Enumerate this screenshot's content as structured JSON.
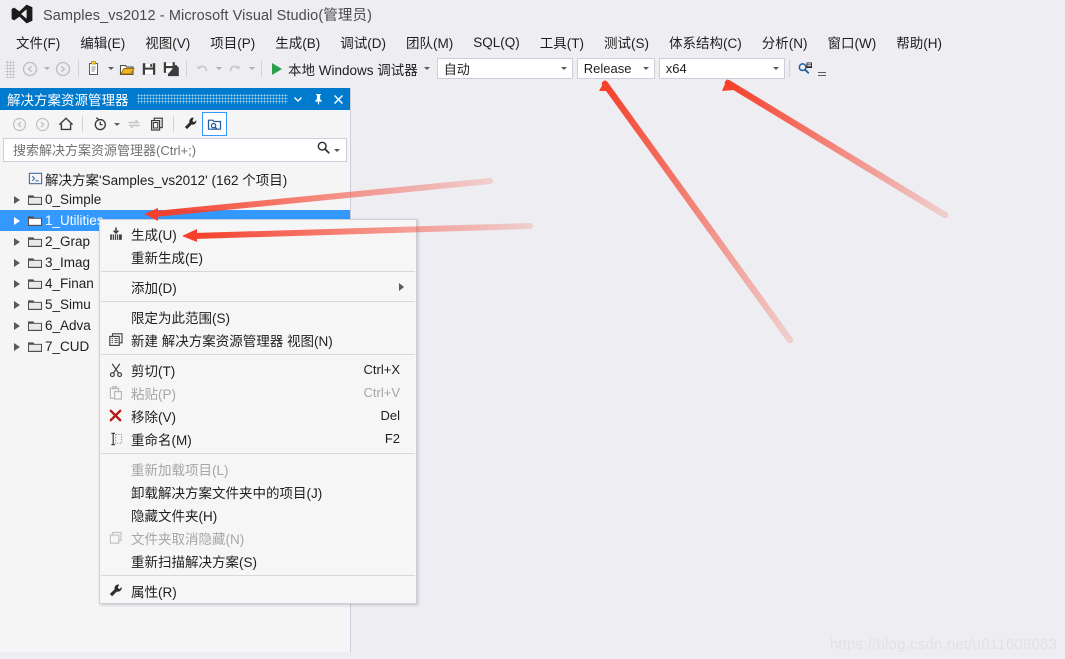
{
  "window": {
    "logo_icon": "visual-studio-logo",
    "title": "Samples_vs2012 - Microsoft Visual Studio(管理员)"
  },
  "menubar": {
    "items": [
      {
        "label": "文件(F)"
      },
      {
        "label": "编辑(E)"
      },
      {
        "label": "视图(V)"
      },
      {
        "label": "项目(P)"
      },
      {
        "label": "生成(B)"
      },
      {
        "label": "调试(D)"
      },
      {
        "label": "团队(M)"
      },
      {
        "label": "SQL(Q)"
      },
      {
        "label": "工具(T)"
      },
      {
        "label": "测试(S)"
      },
      {
        "label": "体系结构(C)"
      },
      {
        "label": "分析(N)"
      },
      {
        "label": "窗口(W)"
      },
      {
        "label": "帮助(H)"
      }
    ]
  },
  "toolbar": {
    "navigate_back_icon": "navigate-back-icon",
    "navigate_forward_icon": "navigate-forward-icon",
    "new_project_icon": "new-project-icon",
    "open_file_icon": "open-file-icon",
    "save_icon": "save-icon",
    "save_all_icon": "save-all-icon",
    "undo_icon": "undo-icon",
    "redo_icon": "redo-icon",
    "start_debug_icon": "play-icon",
    "start_debug_label": "本地 Windows 调试器",
    "debug_type": "自动",
    "configuration": "Release",
    "platform": "x64",
    "find_in_files_icon": "find-in-files-icon",
    "overflow_icon": "toolbar-overflow-icon"
  },
  "solution_explorer": {
    "title": "解决方案资源管理器",
    "header_color": "#007ACC",
    "dropdown_icon": "chevron-down-icon",
    "pin_icon": "pin-icon",
    "close_icon": "close-icon",
    "toolbar": {
      "back_icon": "back-icon",
      "forward_icon": "forward-icon",
      "home_icon": "home-icon",
      "pending_changes_icon": "pending-changes-icon",
      "pending_changes_caret_icon": "chevron-down-icon",
      "sync_icon": "sync-with-active-document-icon",
      "refresh_icon": "refresh-icon",
      "properties_icon": "properties-wrench-icon",
      "show_all_files_icon": "show-all-files-icon"
    },
    "search": {
      "placeholder": "搜索解决方案资源管理器(Ctrl+;)",
      "value": "",
      "search_icon": "search-icon",
      "search_options_icon": "chevron-down-icon"
    },
    "tree": {
      "root": {
        "icon": "solution-icon",
        "label": "解决方案'Samples_vs2012' (162 个项目)"
      },
      "items": [
        {
          "label": "0_Simple",
          "icon": "folder-icon",
          "expander_icon": "chevron-right-icon",
          "selected": false
        },
        {
          "label": "1_Utilities",
          "icon": "folder-icon",
          "expander_icon": "chevron-right-icon",
          "selected": true
        },
        {
          "label": "2_Grap",
          "icon": "folder-icon",
          "expander_icon": "chevron-right-icon",
          "selected": false
        },
        {
          "label": "3_Imag",
          "icon": "folder-icon",
          "expander_icon": "chevron-right-icon",
          "selected": false
        },
        {
          "label": "4_Finan",
          "icon": "folder-icon",
          "expander_icon": "chevron-right-icon",
          "selected": false
        },
        {
          "label": "5_Simu",
          "icon": "folder-icon",
          "expander_icon": "chevron-right-icon",
          "selected": false
        },
        {
          "label": "6_Adva",
          "icon": "folder-icon",
          "expander_icon": "chevron-right-icon",
          "selected": false
        },
        {
          "label": "7_CUD",
          "icon": "folder-icon",
          "expander_icon": "chevron-right-icon",
          "selected": false
        }
      ]
    }
  },
  "context_menu": {
    "items": [
      {
        "label": "生成(U)",
        "icon": "build-icon",
        "shortcut": "",
        "disabled": false,
        "submenu": false,
        "sep_after": false
      },
      {
        "label": "重新生成(E)",
        "icon": "",
        "shortcut": "",
        "disabled": false,
        "submenu": false,
        "sep_after": true
      },
      {
        "label": "添加(D)",
        "icon": "",
        "shortcut": "",
        "disabled": false,
        "submenu": true,
        "sep_after": true
      },
      {
        "label": "限定为此范围(S)",
        "icon": "",
        "shortcut": "",
        "disabled": false,
        "submenu": false,
        "sep_after": false
      },
      {
        "label": "新建 解决方案资源管理器 视图(N)",
        "icon": "new-view-icon",
        "shortcut": "",
        "disabled": false,
        "submenu": false,
        "sep_after": true
      },
      {
        "label": "剪切(T)",
        "icon": "scissors-icon",
        "shortcut": "Ctrl+X",
        "disabled": false,
        "submenu": false,
        "sep_after": false
      },
      {
        "label": "粘贴(P)",
        "icon": "paste-icon",
        "shortcut": "Ctrl+V",
        "disabled": true,
        "submenu": false,
        "sep_after": false
      },
      {
        "label": "移除(V)",
        "icon": "remove-x-icon",
        "shortcut": "Del",
        "disabled": false,
        "submenu": false,
        "sep_after": false
      },
      {
        "label": "重命名(M)",
        "icon": "rename-icon",
        "shortcut": "F2",
        "disabled": false,
        "submenu": false,
        "sep_after": true
      },
      {
        "label": "重新加载项目(L)",
        "icon": "",
        "shortcut": "",
        "disabled": true,
        "submenu": false,
        "sep_after": false
      },
      {
        "label": "卸载解决方案文件夹中的项目(J)",
        "icon": "",
        "shortcut": "",
        "disabled": false,
        "submenu": false,
        "sep_after": false
      },
      {
        "label": "隐藏文件夹(H)",
        "icon": "",
        "shortcut": "",
        "disabled": false,
        "submenu": false,
        "sep_after": false
      },
      {
        "label": "文件夹取消隐藏(N)",
        "icon": "unhide-folder-icon",
        "shortcut": "",
        "disabled": true,
        "submenu": false,
        "sep_after": false
      },
      {
        "label": "重新扫描解决方案(S)",
        "icon": "",
        "shortcut": "",
        "disabled": false,
        "submenu": false,
        "sep_after": true
      },
      {
        "label": "属性(R)",
        "icon": "wrench-icon",
        "shortcut": "",
        "disabled": false,
        "submenu": false,
        "sep_after": false
      }
    ]
  },
  "annotations": {
    "arrow_color": "#F5402C",
    "arrows": [
      {
        "name": "arrow-to-configuration-dropdown"
      },
      {
        "name": "arrow-to-platform-dropdown"
      },
      {
        "name": "arrow-to-selected-project"
      },
      {
        "name": "arrow-to-build-menu-item"
      }
    ]
  },
  "watermark": {
    "text": "https://blog.csdn.net/u011609063"
  }
}
